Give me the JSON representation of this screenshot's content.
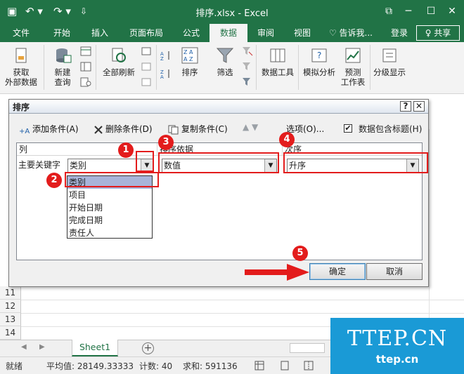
{
  "titlebar": {
    "title": "排序.xlsx - Excel",
    "save_glyph": "▣",
    "undo_glyph": "↶ ▾",
    "redo_glyph": "↷ ▾",
    "customize_glyph": "⇩",
    "restore_glyph": "⧉",
    "minimize_glyph": "─",
    "maximize_glyph": "☐",
    "close_glyph": "✕"
  },
  "tabs": {
    "items": [
      "文件",
      "开始",
      "插入",
      "页面布局",
      "公式",
      "数据",
      "审阅",
      "视图"
    ],
    "active": "数据",
    "tellme": "♡ 告诉我...",
    "login": "登录",
    "share": "♀ 共享"
  },
  "ribbon": {
    "get_data": "获取\n外部数据",
    "new_query": "新建\n查询",
    "refresh_all": "全部刷新",
    "sort": "排序",
    "filter": "筛选",
    "data_tools": "数据工具",
    "what_if": "模拟分析",
    "forecast": "预测\n工作表",
    "outline": "分级显示"
  },
  "rows": [
    "11",
    "12",
    "13",
    "14"
  ],
  "sheet_tab": "Sheet1",
  "add_sheet": "+",
  "statusbar": {
    "ready": "就绪",
    "average": "平均值: 28149.33333",
    "count": "计数: 40",
    "sum": "求和: 591136"
  },
  "dialog": {
    "title": "排序",
    "help": "?",
    "close": "✕",
    "add_level": "添加条件(A)",
    "delete_level": "删除条件(D)",
    "copy_level": "复制条件(C)",
    "move_arrows": "▲   ▼",
    "options": "选项(O)...",
    "has_headers_label": "数据包含标题(H)",
    "has_headers_check": "✔",
    "col_header": "列",
    "sort_on_header": "排序依据",
    "order_header": "次序",
    "primary_key_label": "主要关键字",
    "column_value": "类别",
    "sort_on_value": "数值",
    "order_value": "升序",
    "dropdown_glyph": "▼",
    "options_list": [
      "类别",
      "项目",
      "开始日期",
      "完成日期",
      "责任人"
    ],
    "selected_option": "类别",
    "ok": "确定",
    "cancel": "取消"
  },
  "annotations": [
    "1",
    "2",
    "3",
    "4",
    "5"
  ],
  "watermark": {
    "big": "TTEP.CN",
    "small": "ttep.cn"
  },
  "colors": {
    "excel_green": "#217346",
    "annotation_red": "#e31c1c",
    "watermark_blue": "#1a9ad6"
  }
}
